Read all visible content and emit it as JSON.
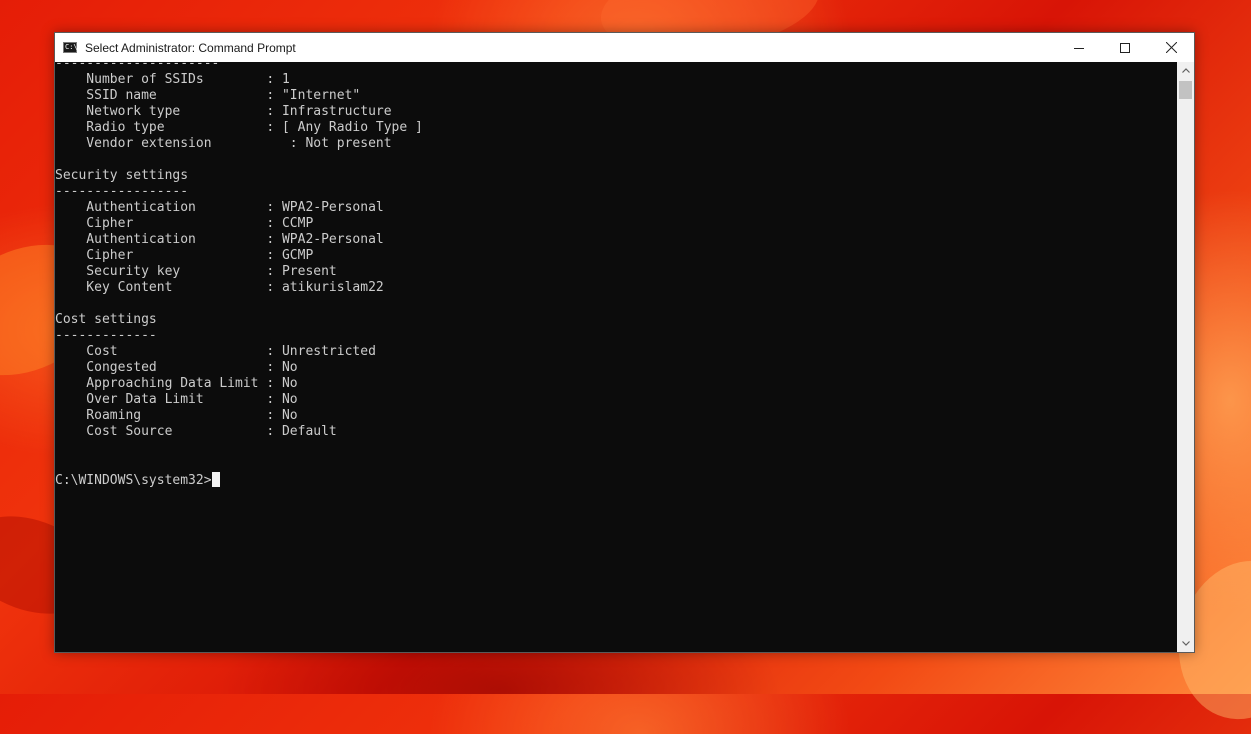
{
  "window": {
    "title": "Select Administrator: Command Prompt",
    "icon_label": "C:\\",
    "controls": [
      "minimize-icon",
      "maximize-icon",
      "close-icon"
    ]
  },
  "console": {
    "lines": [
      "---------------------",
      "    Number of SSIDs        : 1",
      "    SSID name              : \"Internet\"",
      "    Network type           : Infrastructure",
      "    Radio type             : [ Any Radio Type ]",
      "    Vendor extension          : Not present",
      "",
      "Security settings",
      "-----------------",
      "    Authentication         : WPA2-Personal",
      "    Cipher                 : CCMP",
      "    Authentication         : WPA2-Personal",
      "    Cipher                 : GCMP",
      "    Security key           : Present",
      "    Key Content            : atikurislam22",
      "",
      "Cost settings",
      "-------------",
      "    Cost                   : Unrestricted",
      "    Congested              : No",
      "    Approaching Data Limit : No",
      "    Over Data Limit        : No",
      "    Roaming                : No",
      "    Cost Source            : Default",
      "",
      ""
    ],
    "prompt": "C:\\WINDOWS\\system32>"
  },
  "colors": {
    "console_bg": "#0c0c0c",
    "console_text": "#cccccc",
    "titlebar_bg": "#ffffff"
  }
}
